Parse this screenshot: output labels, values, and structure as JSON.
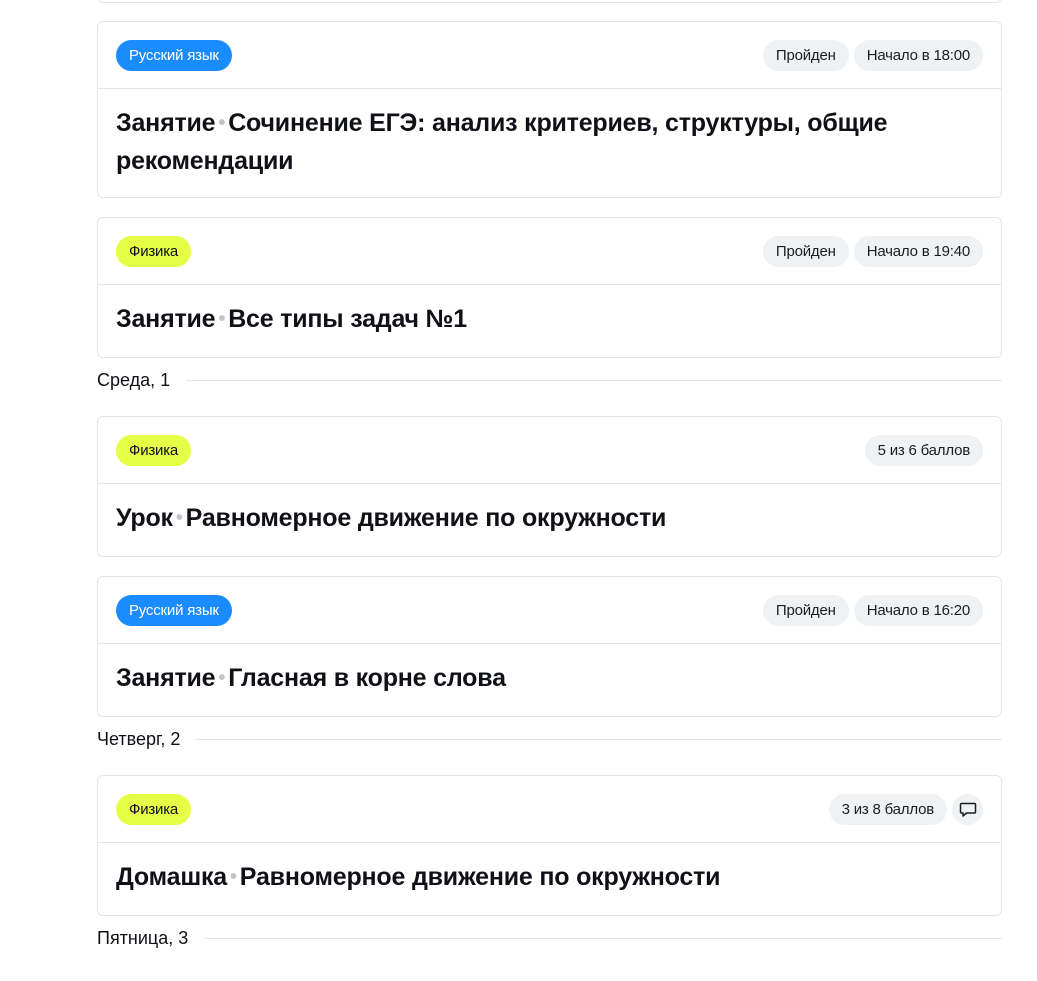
{
  "cards_group_1": [
    {
      "subject": "Русский язык",
      "status": "Пройден",
      "time": "Начало в 18:00",
      "type": "Занятие",
      "title": "Сочинение ЕГЭ: анализ критериев, структуры, общие рекомендации"
    },
    {
      "subject": "Физика",
      "status": "Пройден",
      "time": "Начало в 19:40",
      "type": "Занятие",
      "title": "Все типы задач №1"
    }
  ],
  "day_wed": "Среда, 1",
  "cards_group_2": [
    {
      "subject": "Физика",
      "score": "5 из 6 баллов",
      "type": "Урок",
      "title": "Равномерное движение по окружности"
    },
    {
      "subject": "Русский язык",
      "status": "Пройден",
      "time": "Начало в 16:20",
      "type": "Занятие",
      "title": "Гласная в корне слова"
    }
  ],
  "day_thu": "Четверг, 2",
  "cards_group_3": [
    {
      "subject": "Физика",
      "score": "3 из 8 баллов",
      "icon": "chat-icon",
      "type": "Домашка",
      "title": "Равномерное движение по окружности"
    }
  ],
  "day_fri": "Пятница, 3",
  "colors": {
    "russian": "#1a8cff",
    "physics": "#e4ff45",
    "chip": "#f0f1f3"
  }
}
